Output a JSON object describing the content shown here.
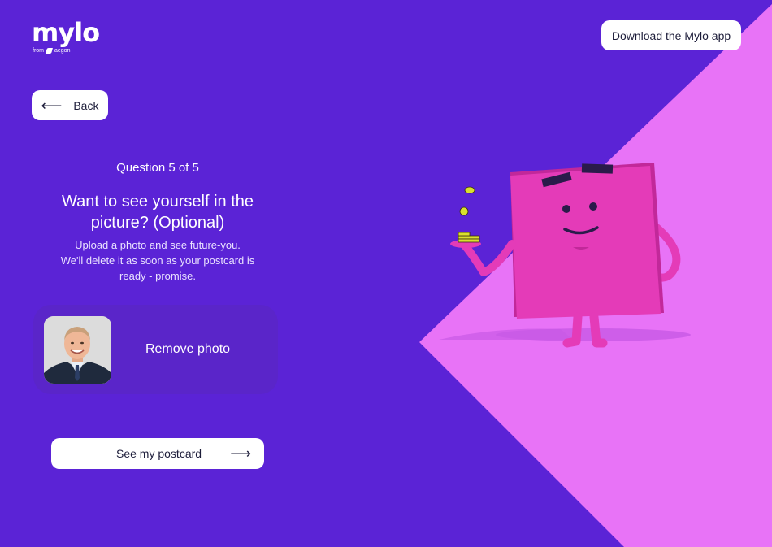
{
  "brand": {
    "logo_text": "mylo",
    "sub_from": "from",
    "sub_partner": "aegon"
  },
  "header": {
    "download_label": "Download the Mylo app"
  },
  "nav": {
    "back_label": "Back",
    "back_arrow": "⟵"
  },
  "question": {
    "counter": "Question 5 of 5",
    "title_line1": "Want to see yourself in the",
    "title_line2": "picture? (Optional)",
    "desc_line1": "Upload a photo and see future-you.",
    "desc_line2": "We'll delete it as soon as your postcard is",
    "desc_line3": "ready - promise."
  },
  "photo": {
    "remove_label": "Remove photo"
  },
  "cta": {
    "label": "See my postcard",
    "arrow": "⟶"
  },
  "colors": {
    "background": "#5b23d6",
    "accent_pink": "#e873f7",
    "character_pink": "#e43bb8",
    "card": "#5a25c9",
    "button_text": "#1d1d3a"
  }
}
